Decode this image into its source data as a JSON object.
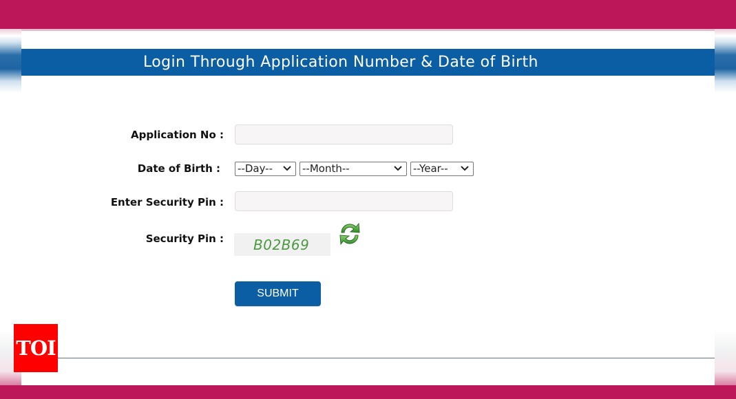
{
  "header": {
    "title": "Login Through Application Number & Date of Birth"
  },
  "form": {
    "application_no": {
      "label": "Application No :",
      "value": "",
      "placeholder": ""
    },
    "date_of_birth": {
      "label": "Date of Birth :",
      "day": {
        "selected": "--Day--"
      },
      "month": {
        "selected": "--Month--"
      },
      "year": {
        "selected": "--Year--"
      }
    },
    "enter_security_pin": {
      "label": "Enter Security Pin :",
      "value": "",
      "placeholder": ""
    },
    "security_pin": {
      "label": "Security Pin :",
      "captcha_text": "B02B69",
      "refresh_icon": "refresh-icon"
    },
    "submit_label": "SUBMIT"
  },
  "watermark": {
    "logo_text": "TOI"
  },
  "colors": {
    "brand_magenta": "#bc1759",
    "header_blue": "#0b5ea3",
    "captcha_green": "#4c9a40",
    "logo_red": "#fe0000"
  }
}
